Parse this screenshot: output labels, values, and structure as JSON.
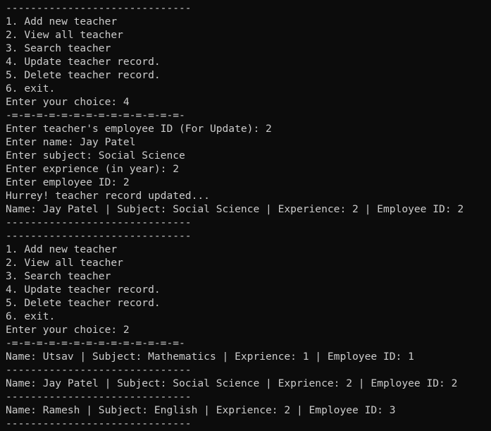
{
  "terminal": {
    "lines": [
      "------------------------------",
      "1. Add new teacher",
      "2. View all teacher",
      "3. Search teacher",
      "4. Update teacher record.",
      "5. Delete teacher record.",
      "6. exit.",
      "Enter your choice: 4",
      "-=-=-=-=-=-=-=-=-=-=-=-=-=-=-",
      "Enter teacher's employee ID (For Update): 2",
      "Enter name: Jay Patel",
      "Enter subject: Social Science",
      "Enter exprience (in year): 2",
      "Enter employee ID: 2",
      "Hurrey! teacher record updated...",
      "Name: Jay Patel | Subject: Social Science | Experience: 2 | Employee ID: 2",
      "------------------------------",
      "------------------------------",
      "1. Add new teacher",
      "2. View all teacher",
      "3. Search teacher",
      "4. Update teacher record.",
      "5. Delete teacher record.",
      "6. exit.",
      "Enter your choice: 2",
      "-=-=-=-=-=-=-=-=-=-=-=-=-=-=-",
      "Name: Utsav | Subject: Mathematics | Exprience: 1 | Employee ID: 1",
      "------------------------------",
      "Name: Jay Patel | Subject: Social Science | Exprience: 2 | Employee ID: 2",
      "------------------------------",
      "Name: Ramesh | Subject: English | Exprience: 2 | Employee ID: 3",
      "------------------------------"
    ]
  }
}
